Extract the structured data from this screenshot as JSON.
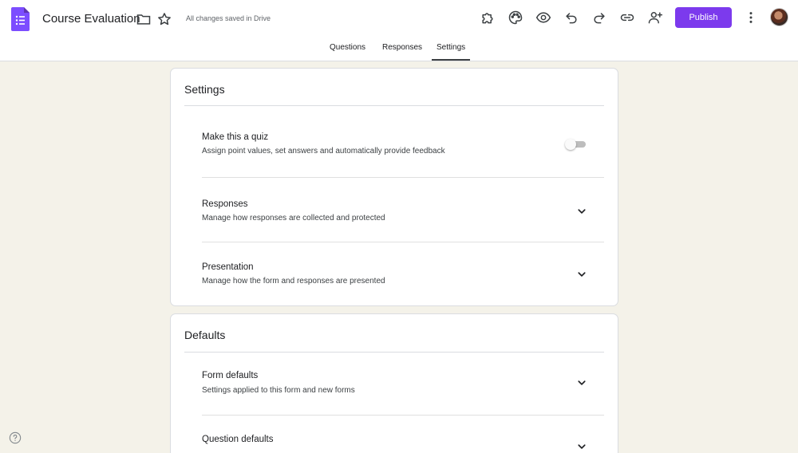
{
  "header": {
    "title": "Course Evaluation",
    "save_status": "All changes saved in Drive",
    "publish_label": "Publish",
    "icons": [
      "forms-logo-icon",
      "folder-icon",
      "star-icon",
      "addons-icon",
      "palette-icon",
      "preview-eye-icon",
      "undo-icon",
      "redo-icon",
      "link-icon",
      "add-collaborator-icon",
      "more-vert-icon"
    ],
    "accent_color": "#7c3aed"
  },
  "tabs": [
    {
      "label": "Questions",
      "active": false
    },
    {
      "label": "Responses",
      "active": false
    },
    {
      "label": "Settings",
      "active": true
    }
  ],
  "settings_card": {
    "title": "Settings",
    "quiz": {
      "title": "Make this a quiz",
      "description": "Assign point values, set answers and automatically provide feedback",
      "enabled": false
    },
    "responses": {
      "title": "Responses",
      "description": "Manage how responses are collected and protected"
    },
    "presentation": {
      "title": "Presentation",
      "description": "Manage how the form and responses are presented"
    }
  },
  "defaults_card": {
    "title": "Defaults",
    "form_defaults": {
      "title": "Form defaults",
      "description": "Settings applied to this form and new forms"
    },
    "question_defaults": {
      "title": "Question defaults"
    }
  }
}
